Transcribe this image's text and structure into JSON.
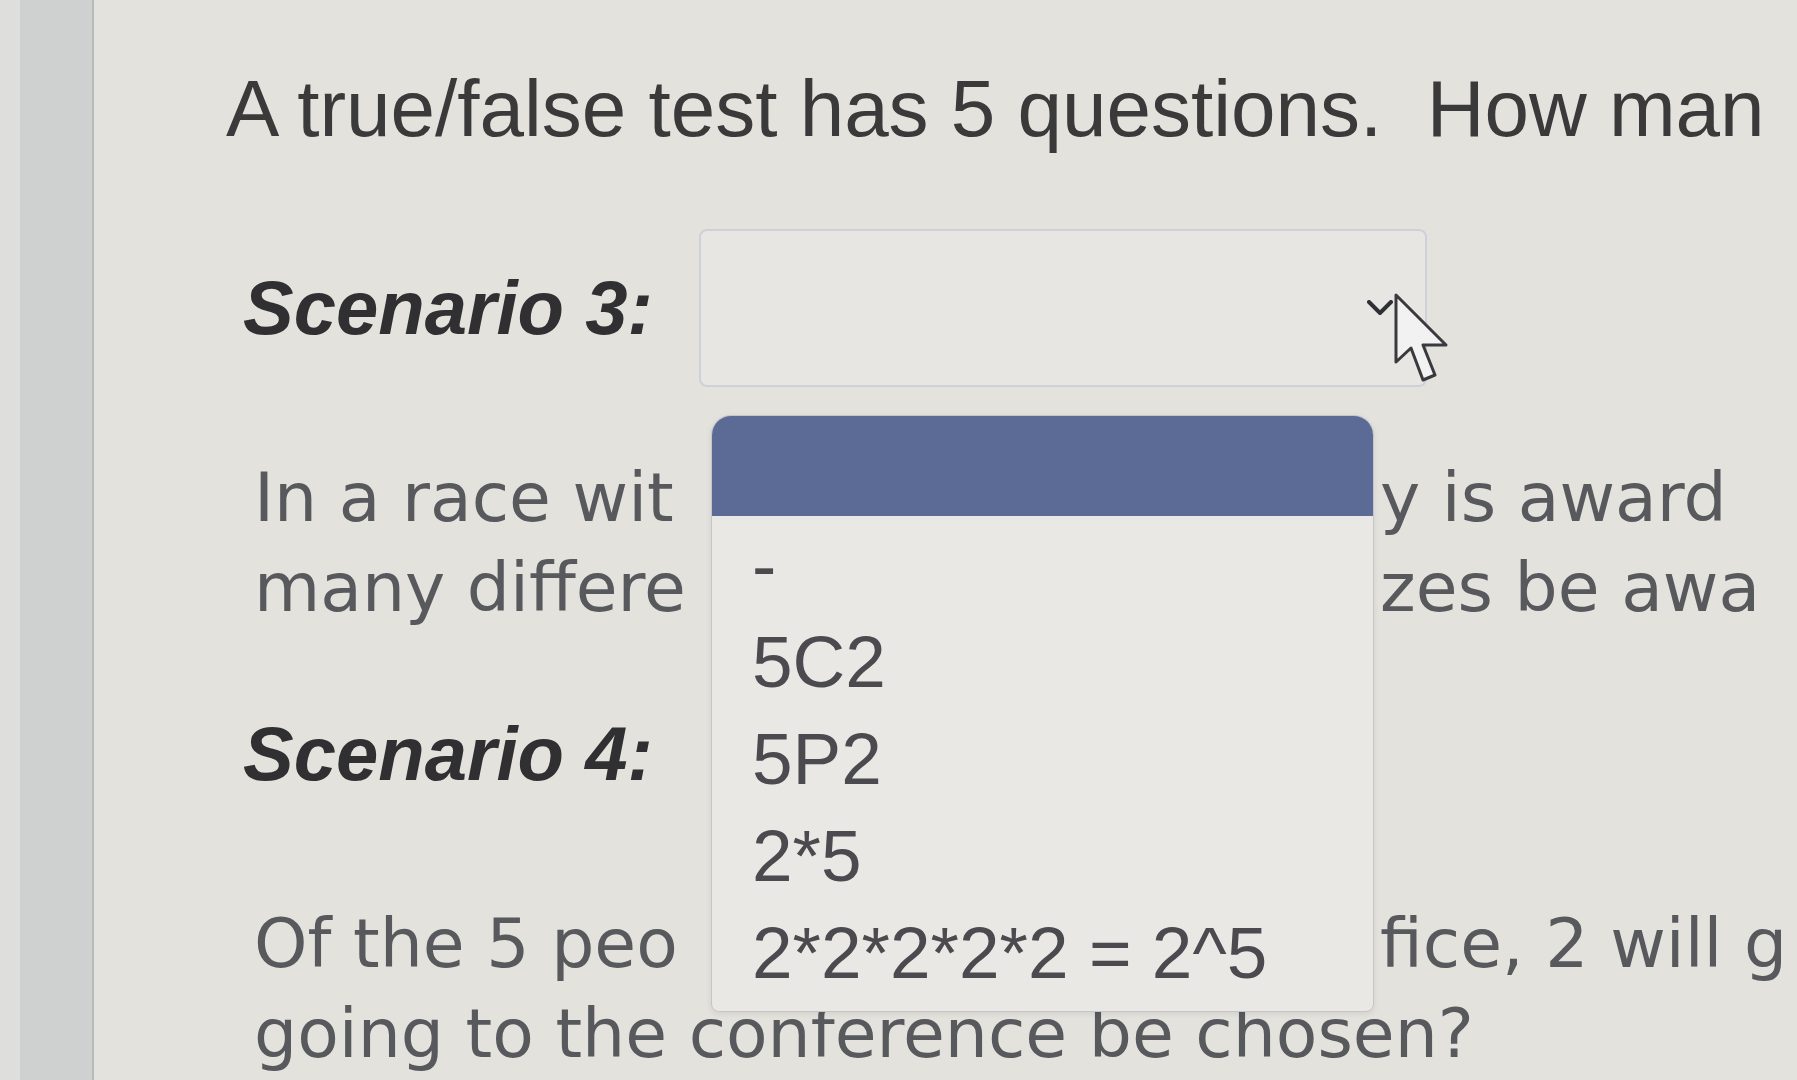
{
  "blocks": [
    {
      "kind": "question",
      "text": "A true/false test has 5 questions.  How man"
    },
    {
      "kind": "scenario",
      "label": "Scenario 3:",
      "select": {
        "expanded": true,
        "options": [
          {
            "selected": true
          },
          {
            "label": "-",
            "selected": false
          },
          {
            "label": "5C2",
            "selected": false
          },
          {
            "label": "5P2",
            "selected": false
          },
          {
            "label": "2*5",
            "selected": false
          },
          {
            "label": "2*2*2*2*2 = 2^5",
            "selected": false
          }
        ]
      }
    },
    {
      "kind": "prompt",
      "lines": [
        {
          "left": "In a race wit",
          "right": "y is award"
        },
        {
          "left": "many differe",
          "right": "zes be awa"
        }
      ]
    },
    {
      "kind": "scenario",
      "label": "Scenario 4:"
    },
    {
      "kind": "prompt",
      "lines": [
        {
          "left": "Of the 5 peo",
          "right": "fice, 2 will g"
        },
        {
          "left": "going to the conference be chosen?"
        }
      ]
    }
  ]
}
